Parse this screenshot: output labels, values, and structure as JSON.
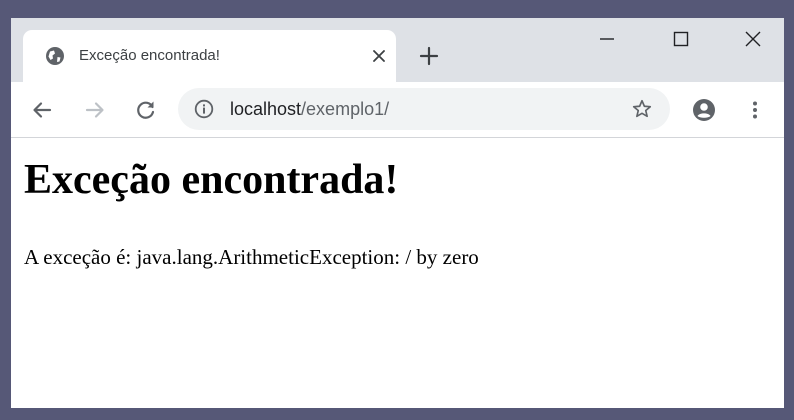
{
  "tab": {
    "title": "Exceção encontrada!",
    "favicon": "globe-icon"
  },
  "window_controls": [
    "minimize-icon",
    "maximize-icon",
    "close-icon"
  ],
  "toolbar": {
    "back": "back-arrow-icon",
    "forward": "forward-arrow-icon",
    "reload": "reload-icon",
    "url_host": "localhost",
    "url_path": "/exemplo1/",
    "site_info": "info-icon",
    "bookmark": "star-icon",
    "profile": "account-icon",
    "menu": "more-vert-icon"
  },
  "page": {
    "heading": "Exceção encontrada!",
    "message": "A exceção é: java.lang.ArithmeticException: / by zero"
  },
  "colors": {
    "frame": "#565877",
    "tabstrip": "#dee1e6",
    "omnibox": "#f1f3f4",
    "icon": "#5f6368"
  }
}
